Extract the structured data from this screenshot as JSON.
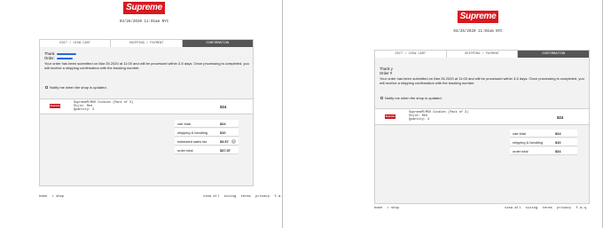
{
  "brand": {
    "logo_text": "Supreme",
    "logo_color": "#d71920"
  },
  "left": {
    "timestamp": "03/26/2020 11:01am NYC",
    "tabs": [
      "EDIT / VIEW CART",
      "SHIPPING / PAYMENT",
      "CONFIRMATION"
    ],
    "thank_label": "Thank",
    "order_label": "Order:",
    "message": "Your order has been submitted on Mar 26 2020 at 11:00 and will be processed within 3-5 days. Once processing is completed, you will receive a shipping confirmation with the tracking number.",
    "notify_label": "Notify me when the shop is updated.",
    "item": {
      "thumb_text": "Supreme",
      "name": "Supreme®/MSO Cookies (Pack of 3)",
      "style": "Style: Red",
      "quantity": "Quantity: 3",
      "price": "$24"
    },
    "totals": [
      {
        "label": "cart total",
        "value": "$24"
      },
      {
        "label": "shipping & handling",
        "value": "$10"
      },
      {
        "label": "estimated sales tax",
        "value": "$3.57"
      },
      {
        "label": "order total",
        "value": "$37.57"
      }
    ],
    "footer_left": [
      "home",
      "> shop"
    ],
    "footer_right": [
      "view all",
      "sizing",
      "terms",
      "privacy",
      "f.a.q."
    ]
  },
  "right": {
    "timestamp": "03/26/2020 11:04am NYC",
    "tabs": [
      "EDIT / VIEW CART",
      "SHIPPING / PAYMENT",
      "CONFIRMATION"
    ],
    "thank_label": "Thank y",
    "order_label": "Order #",
    "message": "Your order has been submitted on Mar 26 2020 at 11:00 and will be processed within 3-5 days. Once processing is completed, you will receive a shipping confirmation with the tracking number.",
    "notify_label": "Notify me when the shop is updated.",
    "item": {
      "thumb_text": "Supreme",
      "name": "Supreme®/MSO Cookies (Pack of 3)",
      "style": "Style: Red",
      "quantity": "Quantity: 3",
      "price": "$24"
    },
    "totals": [
      {
        "label": "cart total",
        "value": "$24"
      },
      {
        "label": "shipping & handling",
        "value": "$10"
      },
      {
        "label": "order total",
        "value": "$34"
      }
    ],
    "footer_left": [
      "home",
      "> shop"
    ],
    "footer_right": [
      "view all",
      "sizing",
      "terms",
      "privacy",
      "f.a.q."
    ]
  },
  "icons": {
    "info": "info-icon"
  }
}
